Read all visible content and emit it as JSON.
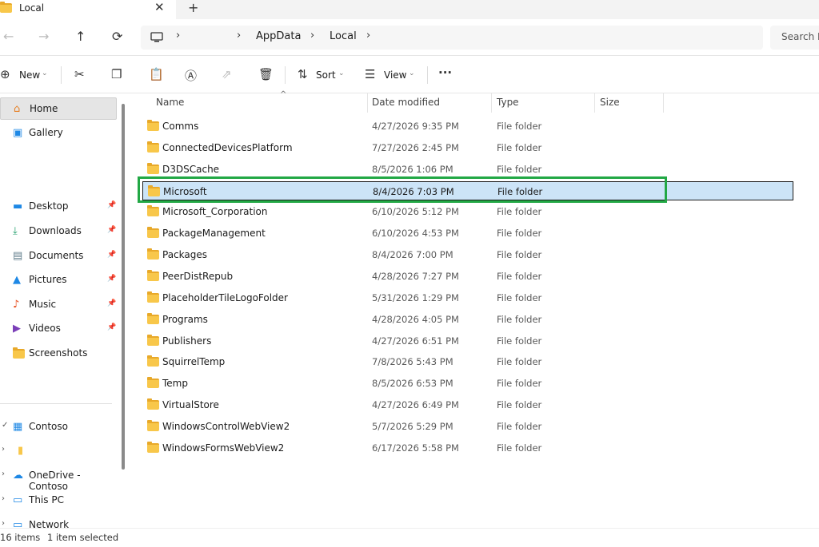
{
  "tab": {
    "title": "Local",
    "close": "✕",
    "add": "+"
  },
  "nav": {
    "back": "←",
    "forward": "→",
    "up": "↑",
    "refresh": "⟳",
    "breadcrumbs": [
      "AppData",
      "Local"
    ],
    "search_placeholder": "Search L"
  },
  "commands": {
    "new_label": "New",
    "sort_label": "Sort",
    "view_label": "View",
    "more": "···"
  },
  "sidebar": {
    "items": [
      {
        "label": "Home",
        "icon": "home-icon"
      },
      {
        "label": "Gallery",
        "icon": "gallery-icon"
      },
      {
        "label": "Desktop",
        "icon": "desktop-icon"
      },
      {
        "label": "Downloads",
        "icon": "download-icon"
      },
      {
        "label": "Documents",
        "icon": "documents-icon"
      },
      {
        "label": "Pictures",
        "icon": "pictures-icon"
      },
      {
        "label": "Music",
        "icon": "music-icon"
      },
      {
        "label": "Videos",
        "icon": "videos-icon"
      },
      {
        "label": "Screenshots",
        "icon": "folder-icon"
      },
      {
        "label": "Contoso",
        "icon": "building-icon"
      },
      {
        "label": "",
        "icon": "folder-icon"
      },
      {
        "label": "OneDrive - Contoso",
        "icon": "cloud-icon"
      },
      {
        "label": "This PC",
        "icon": "pc-icon"
      },
      {
        "label": "Network",
        "icon": "network-icon"
      }
    ]
  },
  "columns": {
    "name": "Name",
    "date": "Date modified",
    "type": "Type",
    "size": "Size"
  },
  "files": [
    {
      "name": "Comms",
      "date": "4/27/2026 9:35 PM",
      "type": "File folder"
    },
    {
      "name": "ConnectedDevicesPlatform",
      "date": "7/27/2026 2:45 PM",
      "type": "File folder"
    },
    {
      "name": "D3DSCache",
      "date": "8/5/2026 1:06 PM",
      "type": "File folder"
    },
    {
      "name": "Microsoft",
      "date": "8/4/2026 7:03 PM",
      "type": "File folder",
      "selected": true
    },
    {
      "name": "Microsoft_Corporation",
      "date": "6/10/2026 5:12 PM",
      "type": "File folder"
    },
    {
      "name": "PackageManagement",
      "date": "6/10/2026 4:53 PM",
      "type": "File folder"
    },
    {
      "name": "Packages",
      "date": "8/4/2026 7:00 PM",
      "type": "File folder"
    },
    {
      "name": "PeerDistRepub",
      "date": "4/28/2026 7:27 PM",
      "type": "File folder"
    },
    {
      "name": "PlaceholderTileLogoFolder",
      "date": "5/31/2026 1:29 PM",
      "type": "File folder"
    },
    {
      "name": "Programs",
      "date": "4/28/2026 4:05 PM",
      "type": "File folder"
    },
    {
      "name": "Publishers",
      "date": "4/27/2026 6:51 PM",
      "type": "File folder"
    },
    {
      "name": "SquirrelTemp",
      "date": "7/8/2026 5:43 PM",
      "type": "File folder"
    },
    {
      "name": "Temp",
      "date": "8/5/2026 6:53 PM",
      "type": "File folder"
    },
    {
      "name": "VirtualStore",
      "date": "4/27/2026 6:49 PM",
      "type": "File folder"
    },
    {
      "name": "WindowsControlWebView2",
      "date": "5/7/2026 5:29 PM",
      "type": "File folder"
    },
    {
      "name": "WindowsFormsWebView2",
      "date": "6/17/2026 5:58 PM",
      "type": "File folder"
    }
  ],
  "status": {
    "count": "16 items",
    "selection": "1 item selected"
  },
  "colors": {
    "accent": "#0067c0",
    "selection": "#cce4f7",
    "highlight": "#22a845",
    "folder": "#f8c74a"
  }
}
